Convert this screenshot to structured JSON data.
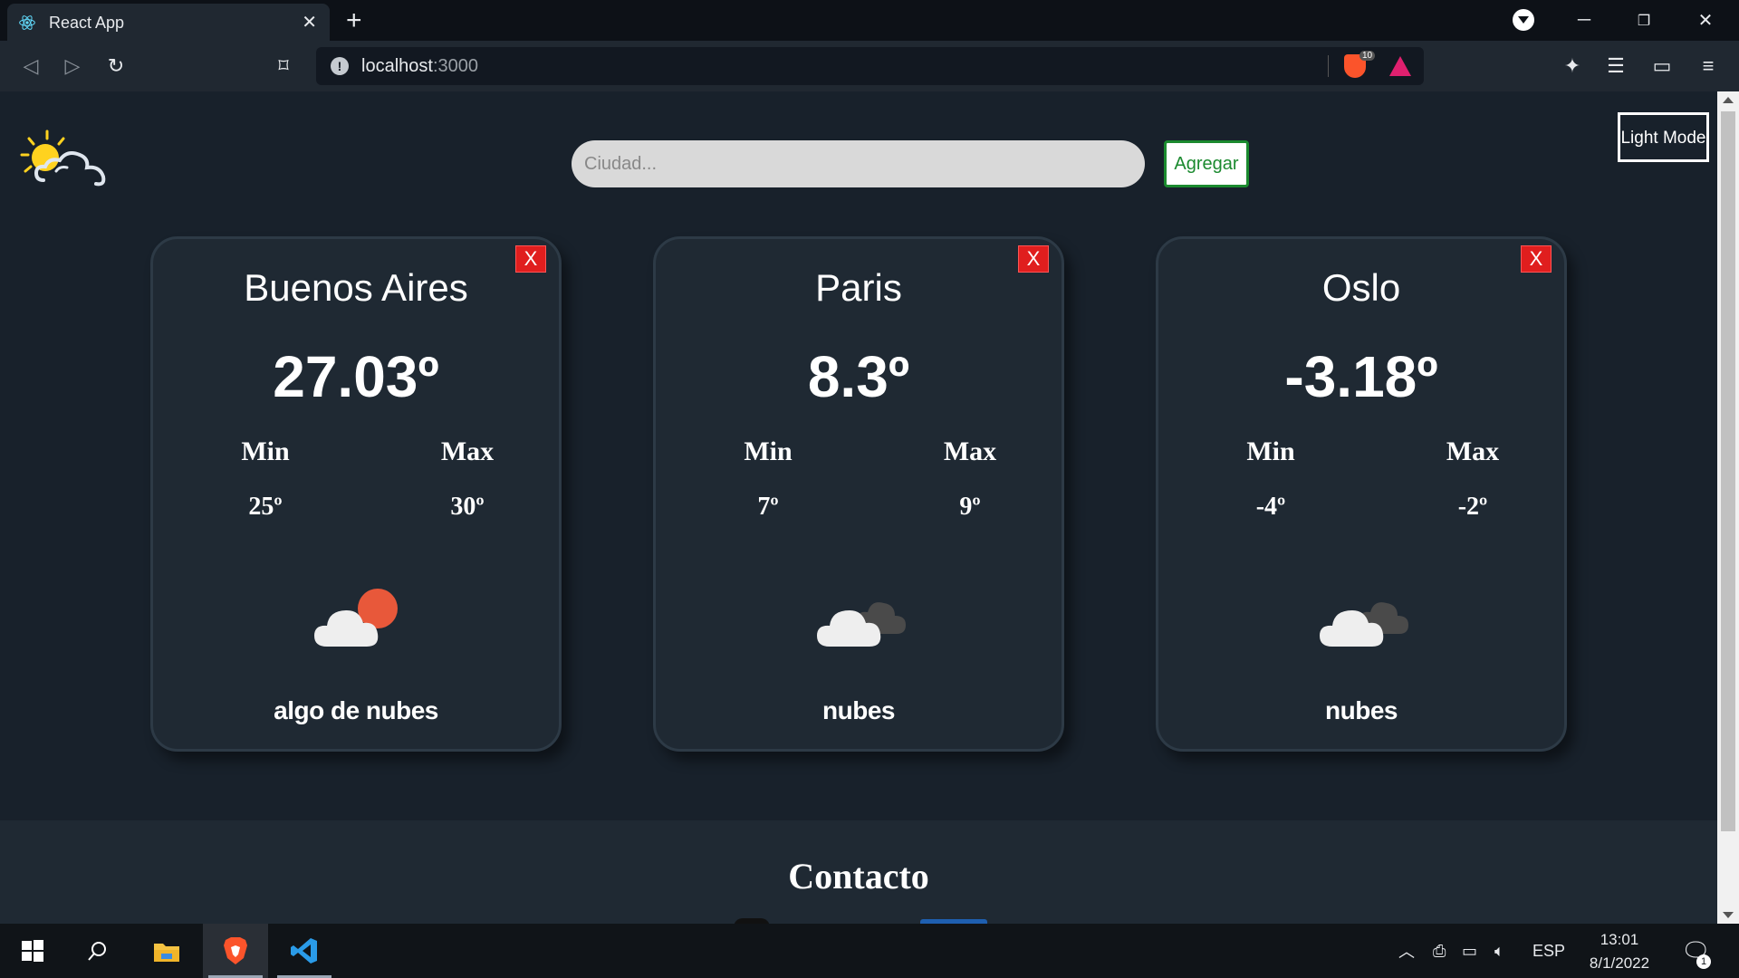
{
  "browser": {
    "tab_title": "React App",
    "url_host": "localhost",
    "url_port": ":3000",
    "shield_count": "10"
  },
  "app": {
    "search_placeholder": "Ciudad...",
    "add_button": "Agregar",
    "mode_button": "Light Mode",
    "close_label": "X",
    "min_label": "Min",
    "max_label": "Max",
    "cards": [
      {
        "city": "Buenos Aires",
        "temp": "27.03º",
        "min": "25º",
        "max": "30º",
        "description": "algo de nubes",
        "icon": "few-clouds-day-icon"
      },
      {
        "city": "Paris",
        "temp": "8.3º",
        "min": "7º",
        "max": "9º",
        "description": "nubes",
        "icon": "broken-clouds-icon"
      },
      {
        "city": "Oslo",
        "temp": "-3.18º",
        "min": "-4º",
        "max": "-2º",
        "description": "nubes",
        "icon": "broken-clouds-icon"
      }
    ],
    "contact_title": "Contacto"
  },
  "taskbar": {
    "language": "ESP",
    "time": "13:01",
    "date": "8/1/2022",
    "notifications": "1"
  },
  "colors": {
    "page_bg": "#18212b",
    "card_bg": "#1f2933",
    "close_red": "#e01e1e",
    "add_green": "#1b8a2f"
  }
}
